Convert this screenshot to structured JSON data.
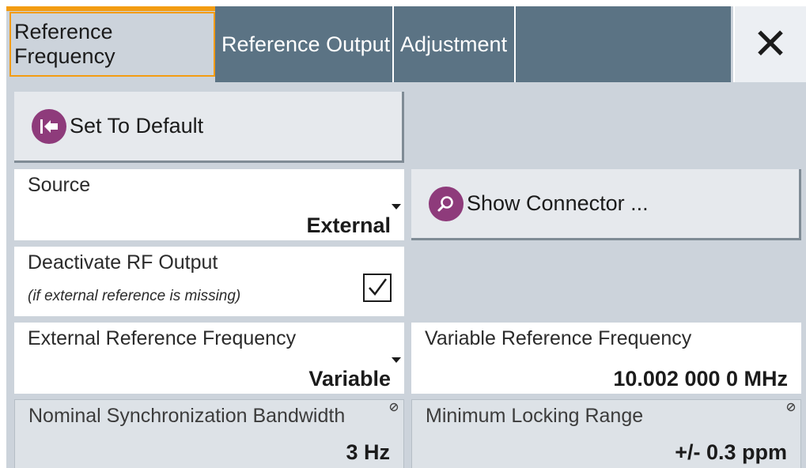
{
  "tabs": [
    {
      "label": "Reference Frequency",
      "active": true
    },
    {
      "label": "Reference Output",
      "active": false
    },
    {
      "label": "Adjustment",
      "active": false
    }
  ],
  "close_icon": "close-icon",
  "set_default": {
    "label": "Set To Default",
    "icon": "set-default-icon"
  },
  "source": {
    "label": "Source",
    "value": "External"
  },
  "show_connector": {
    "label": "Show Connector ...",
    "icon": "search-icon"
  },
  "deactivate_rf": {
    "label": "Deactivate RF Output",
    "sublabel": "(if external reference is missing)",
    "checked": true
  },
  "ext_ref_freq": {
    "label": "External Reference Frequency",
    "value": "Variable"
  },
  "var_ref_freq": {
    "label": "Variable Reference Frequency",
    "value": "10.002 000 0 MHz"
  },
  "nominal_sync_bw": {
    "label": "Nominal Synchronization Bandwidth",
    "value": "3 Hz"
  },
  "min_locking_range": {
    "label": "Minimum Locking Range",
    "value": "+/- 0.3 ppm"
  },
  "colors": {
    "accent": "#f39c12",
    "tab_inactive": "#5b7384",
    "panel": "#ccd3db",
    "icon_circle": "#8e3b7b"
  }
}
